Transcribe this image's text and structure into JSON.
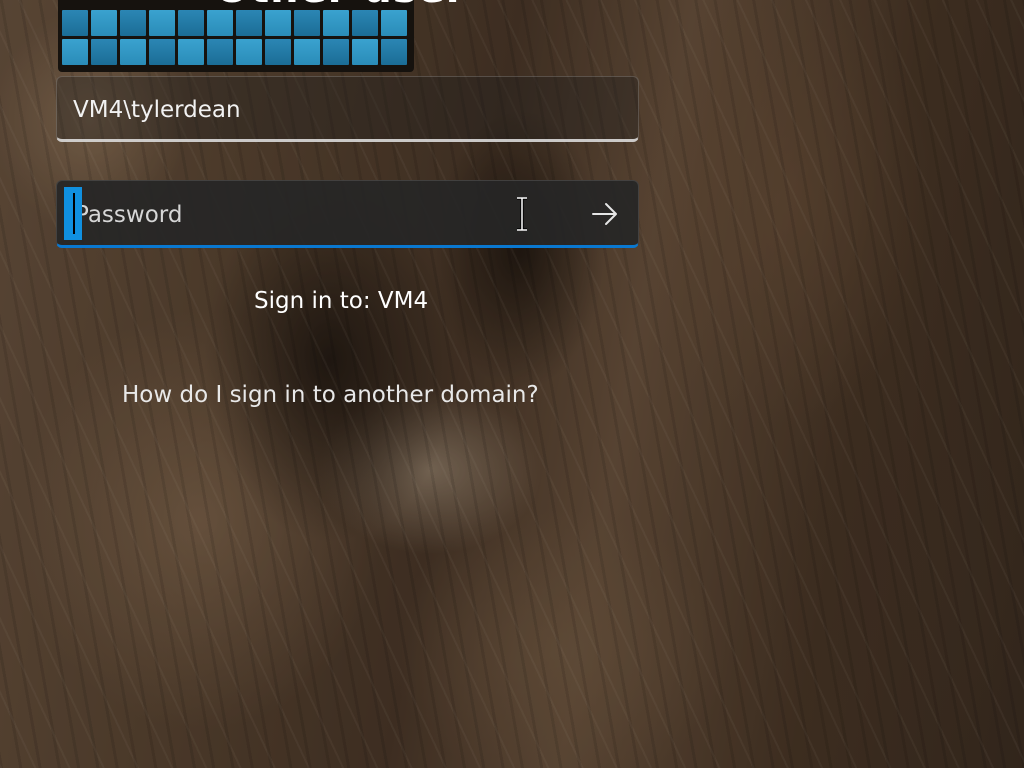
{
  "header": {
    "title": "Other user"
  },
  "login": {
    "username_value": "VM4\\tylerdean",
    "password_placeholder": "Password",
    "sign_in_to": "Sign in to: VM4",
    "domain_help_link": "How do I sign in to another domain?"
  },
  "icons": {
    "submit": "arrow-right-icon",
    "cursor": "i-beam-cursor-icon",
    "avatar": "user-tile-icon"
  },
  "colors": {
    "accent": "#0a78d0",
    "caret": "#1090e0"
  }
}
